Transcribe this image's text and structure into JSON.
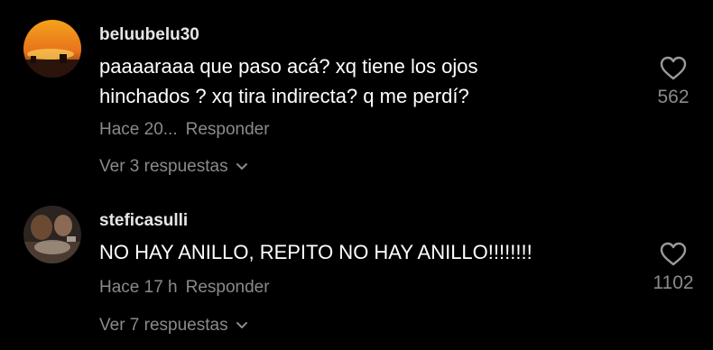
{
  "comments": [
    {
      "username": "beluubelu30",
      "text_lines": [
        "paaaaraaa que paso acá? xq tiene los ojos",
        "hinchados ? xq tira indirecta? q me perdí?"
      ],
      "time": "Hace 20...",
      "reply_label": "Responder",
      "view_replies": "Ver 3 respuestas",
      "likes": "562"
    },
    {
      "username": "steficasulli",
      "text_lines": [
        "NO HAY ANILLO, REPITO NO HAY ANILLO!!!!!!!!"
      ],
      "time": "Hace 17 h",
      "reply_label": "Responder",
      "view_replies": "Ver 7 respuestas",
      "likes": "1102"
    }
  ],
  "icons": {
    "like": "heart-outline-icon",
    "expand": "chevron-down-icon"
  },
  "colors": {
    "background": "#000000",
    "text": "#ffffff",
    "secondary": "#8a8a8a"
  }
}
